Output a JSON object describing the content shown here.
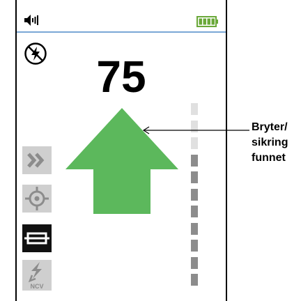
{
  "status_bar": {
    "volume_icon": "speaker-volume-icon",
    "battery_icon": "battery-full-icon",
    "accent_color": "#7aa7d6"
  },
  "indicators": {
    "no_flash_icon": "flash-off-icon"
  },
  "reading": {
    "value": "75"
  },
  "signal_arrow": {
    "icon": "arrow-up-icon",
    "color": "#5cb85c"
  },
  "modes": [
    {
      "icon": "double-chevron-right-icon",
      "selected": false
    },
    {
      "icon": "crosshair-icon",
      "selected": false
    },
    {
      "icon": "fuse-icon",
      "selected": true
    },
    {
      "icon": "ncv-icon",
      "label": "NCV",
      "selected": false
    }
  ],
  "meter": {
    "segments": 11,
    "lit_segments": 8
  },
  "callout": {
    "lines": [
      "Bryter/",
      "sikring",
      "funnet"
    ]
  }
}
